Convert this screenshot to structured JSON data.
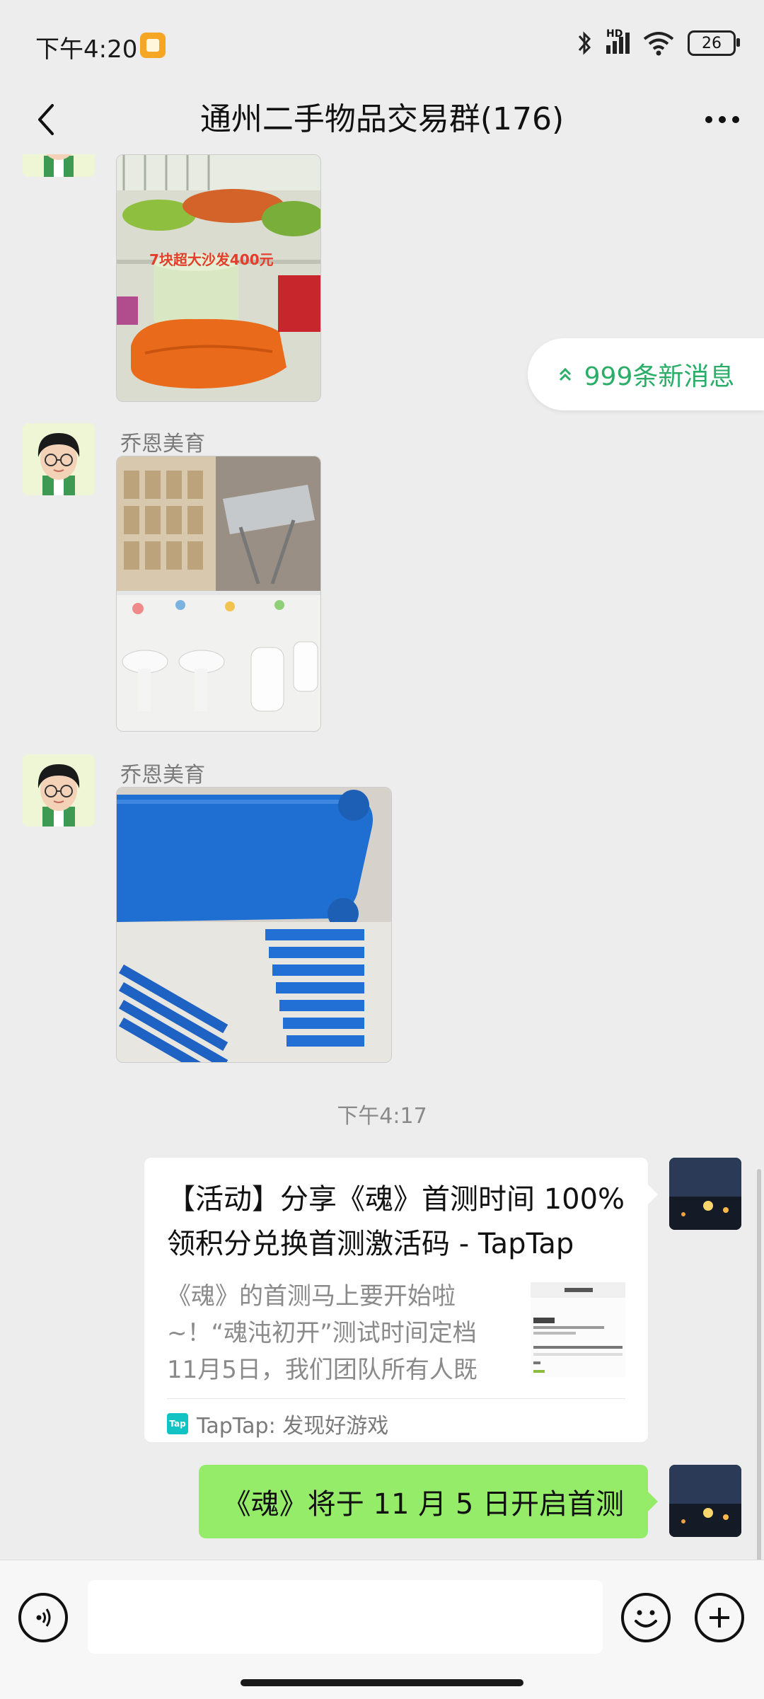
{
  "status_bar": {
    "time": "下午4:20",
    "network": "HD",
    "battery": "26"
  },
  "nav": {
    "title": "通州二手物品交易群(176)"
  },
  "new_messages": {
    "label": "999条新消息"
  },
  "messages": [
    {
      "type": "image",
      "photo_text": "7块超大沙发400元"
    },
    {
      "type": "image",
      "sender": "乔恩美育"
    },
    {
      "type": "image",
      "sender": "乔恩美育"
    },
    {
      "type": "timestamp",
      "text": "下午4:17"
    },
    {
      "type": "link_card",
      "title": "【活动】分享《魂》首测时间 100%领积分兑换首测激活码 - TapTap",
      "description": "《魂》的首测马上要开始啦~！“魂沌初开”测试时间定档11月5日，我们团队所有人既兴奋…",
      "source": "TapTap: 发现好游戏",
      "logo": "Tap"
    },
    {
      "type": "text",
      "text": "《魂》将于 11 月 5 日开启首测"
    }
  ],
  "colors": {
    "background": "#ededed",
    "bubble_green": "#95ec69",
    "accent_green": "#2aae67"
  },
  "icons": {
    "back": "chevron-left-icon",
    "more": "more-dots-icon",
    "voice": "voice-icon",
    "emoji": "emoji-icon",
    "plus": "plus-icon"
  }
}
